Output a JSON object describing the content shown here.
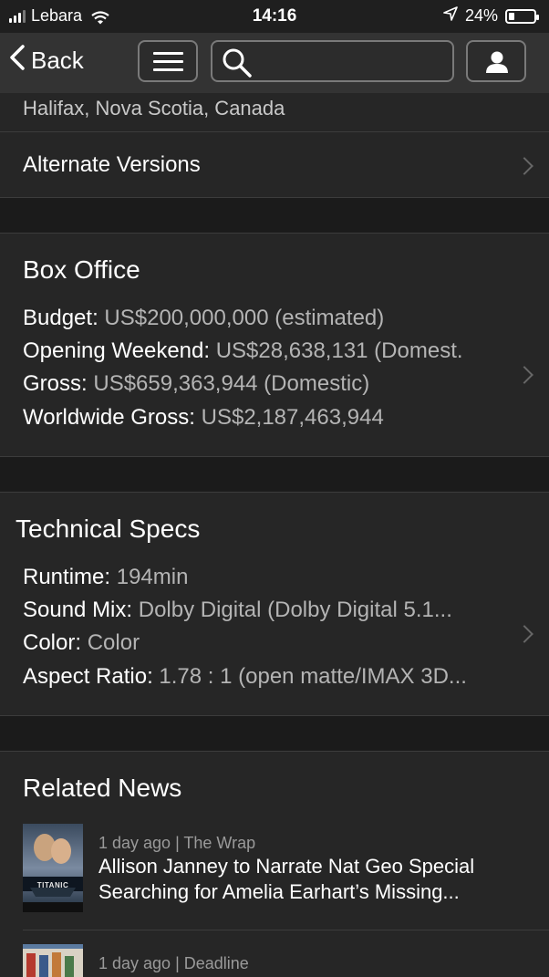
{
  "status": {
    "carrier": "Lebara",
    "time": "14:16",
    "battery": "24%",
    "battery_level": 0.24
  },
  "nav": {
    "back_label": "Back",
    "menu_icon": "hamburger-icon",
    "search_icon": "search-icon",
    "user_icon": "user-icon"
  },
  "location": "Halifax, Nova Scotia, Canada",
  "alternate_versions": "Alternate Versions",
  "box_office": {
    "title": "Box Office",
    "rows": [
      {
        "label": "Budget:",
        "value": "US$200,000,000 (estimated)"
      },
      {
        "label": "Opening Weekend:",
        "value": "US$28,638,131 (Domest."
      },
      {
        "label": "Gross:",
        "value": "US$659,363,944 (Domestic)"
      },
      {
        "label": "Worldwide Gross:",
        "value": "US$2,187,463,944"
      }
    ]
  },
  "technical_specs": {
    "title": "Technical Specs",
    "rows": [
      {
        "label": "Runtime:",
        "value": "194min"
      },
      {
        "label": "Sound Mix:",
        "value": "Dolby Digital (Dolby Digital 5.1..."
      },
      {
        "label": "Color:",
        "value": "Color"
      },
      {
        "label": "Aspect Ratio:",
        "value": "1.78 : 1 (open matte/IMAX 3D..."
      }
    ]
  },
  "related_news": {
    "title": "Related News",
    "items": [
      {
        "meta": "1 day ago | The Wrap",
        "title_line1": "Allison Janney to Narrate Nat Geo Special",
        "title_line2": "Searching for Amelia Earhart’s Missing...",
        "poster_text": "TITANIC"
      },
      {
        "meta": "1 day ago | Deadline"
      }
    ]
  },
  "colors": {
    "background": "#1b1b1b",
    "panel": "#262626",
    "nav": "#333333",
    "value_text": "#b4b4b4"
  }
}
